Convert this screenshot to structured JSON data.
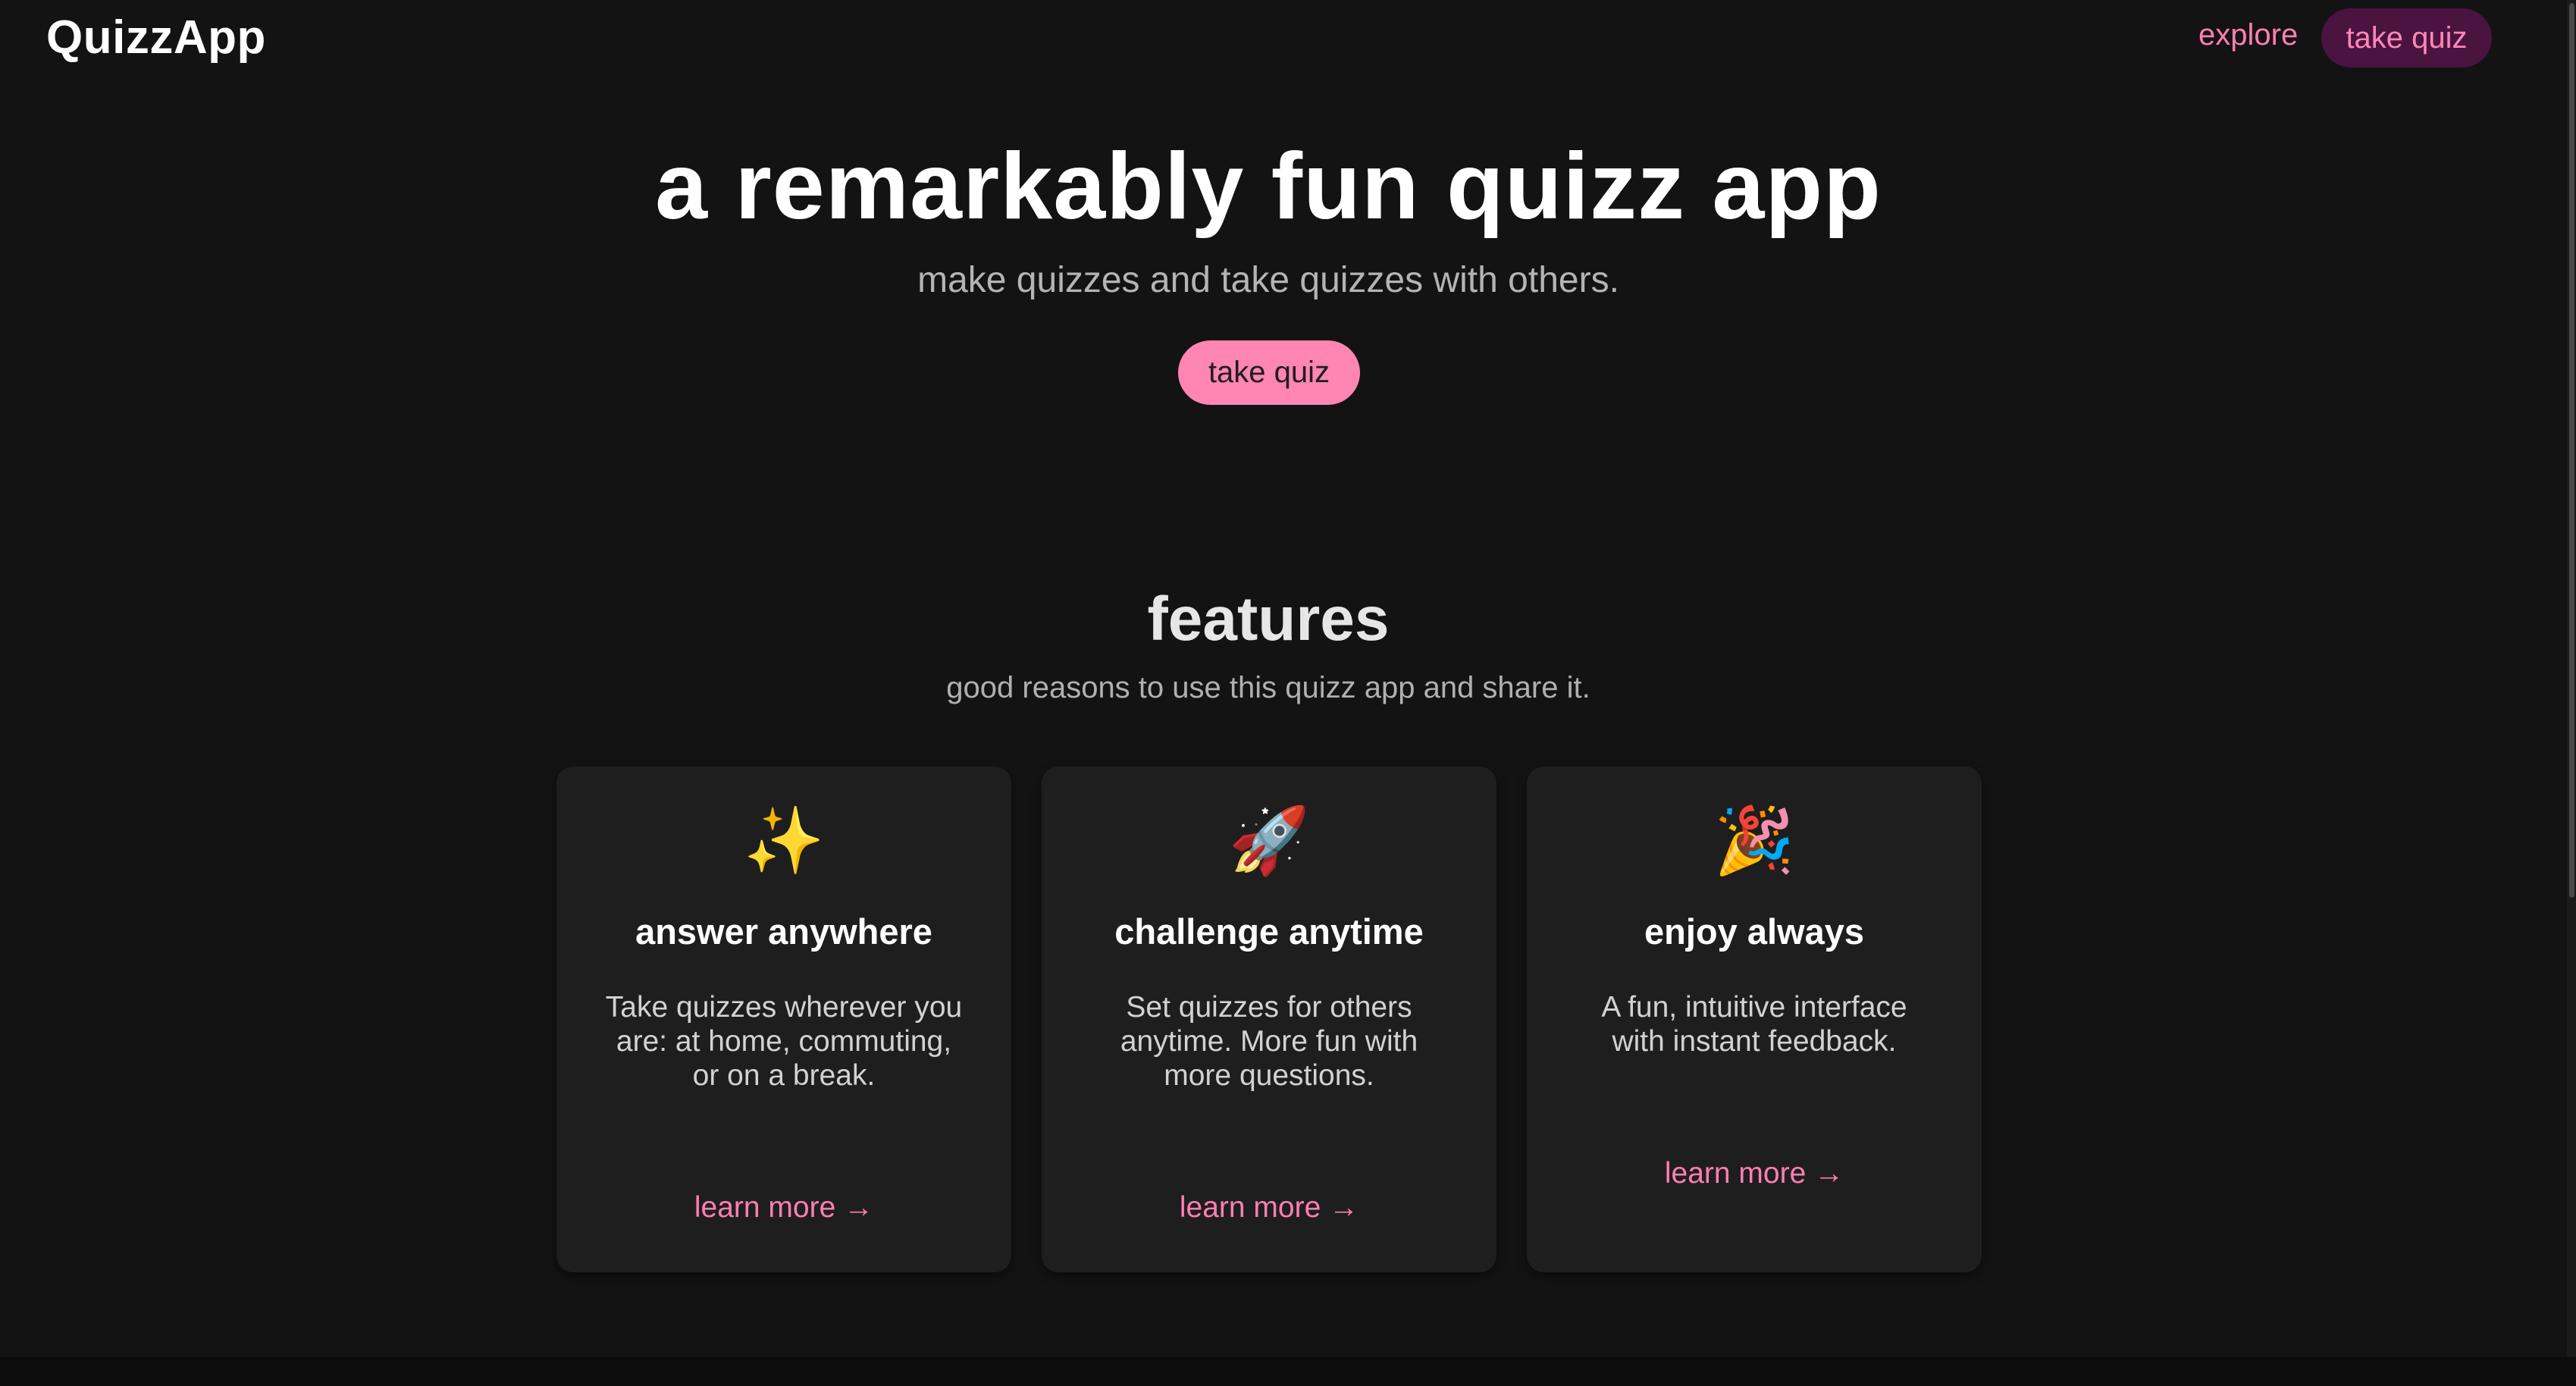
{
  "header": {
    "brand": "QuizzApp",
    "nav": {
      "explore_label": "explore",
      "take_quiz_label": "take quiz"
    }
  },
  "hero": {
    "title": "a remarkably fun quizz app",
    "subtitle": "make quizzes and take quizzes with others.",
    "cta_label": "take quiz"
  },
  "features": {
    "title": "features",
    "subtitle": "good reasons to use this quizz app and share it.",
    "cards": [
      {
        "icon": "sparkles-icon",
        "glyph": "✨",
        "title": "answer anywhere",
        "description": "Take quizzes wherever you are: at home, commuting, or on a break.",
        "link_label": "learn more →"
      },
      {
        "icon": "rocket-icon",
        "glyph": "🚀",
        "title": "challenge anytime",
        "description": "Set quizzes for others anytime. More fun with more questions.",
        "link_label": "learn more →"
      },
      {
        "icon": "party-popper-icon",
        "glyph": "🎉",
        "title": "enjoy always",
        "description": "A fun, intuitive interface with instant feedback.",
        "link_label": "learn more →"
      }
    ]
  },
  "colors": {
    "background": "#131313",
    "card": "#1e1e1e",
    "accent": "#ff85b2",
    "accent_dark": "#4a1340"
  }
}
